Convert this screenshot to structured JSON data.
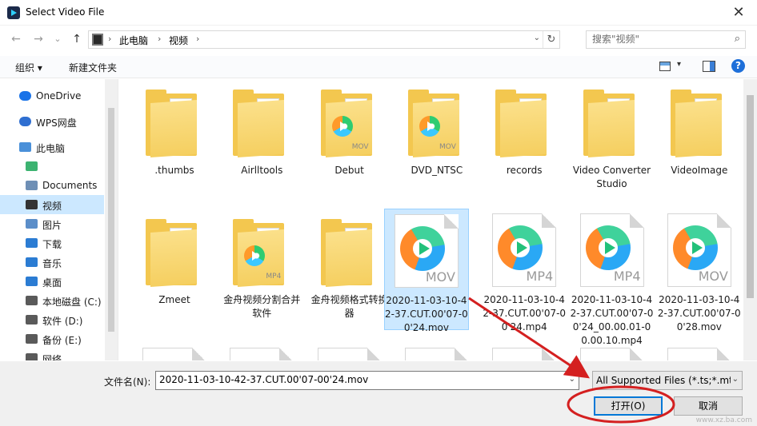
{
  "window": {
    "title": "Select Video File",
    "close_glyph": "✕"
  },
  "nav": {
    "back_glyph": "←",
    "forward_glyph": "→",
    "recent_glyph": "⌄",
    "up_glyph": "↑",
    "breadcrumb": [
      "此电脑",
      "视频"
    ],
    "crumb_sep": "›",
    "dropdown_glyph": "⌄",
    "refresh_glyph": "↻",
    "search_placeholder": "搜索\"视频\"",
    "search_glyph": "⌕"
  },
  "toolbar": {
    "organize_label": "组织 ▾",
    "new_folder_label": "新建文件夹",
    "help_label": "?",
    "view_dd": "▾"
  },
  "sidebar": {
    "items": [
      {
        "label": "OneDrive",
        "icon": "cloud-icon",
        "color": "#1a73e8"
      },
      {
        "label": "WPS网盘",
        "icon": "cloud-icon",
        "color": "#2f6fd1"
      },
      {
        "label": "此电脑",
        "icon": "computer-icon",
        "color": "#4a90d9"
      },
      {
        "label": "",
        "icon": "app-icon",
        "color": "#3cb371"
      },
      {
        "label": "Documents",
        "icon": "document-icon",
        "color": "#6e8fb5"
      },
      {
        "label": "视频",
        "icon": "video-folder-icon",
        "color": "#333333"
      },
      {
        "label": "图片",
        "icon": "picture-icon",
        "color": "#5b8ec9"
      },
      {
        "label": "下载",
        "icon": "download-icon",
        "color": "#2b7cd3"
      },
      {
        "label": "音乐",
        "icon": "music-icon",
        "color": "#2b7cd3"
      },
      {
        "label": "桌面",
        "icon": "desktop-icon",
        "color": "#2b7cd3"
      },
      {
        "label": "本地磁盘 (C:)",
        "icon": "drive-icon",
        "color": "#5a5a5a"
      },
      {
        "label": "软件 (D:)",
        "icon": "drive-icon",
        "color": "#5a5a5a"
      },
      {
        "label": "备份 (E:)",
        "icon": "drive-icon",
        "color": "#5a5a5a"
      },
      {
        "label": "网络",
        "icon": "network-icon",
        "color": "#5a5a5a"
      }
    ],
    "selected_index": 5
  },
  "files": [
    {
      "name": ".thumbs",
      "kind": "folder",
      "ext": ""
    },
    {
      "name": "Airlltools",
      "kind": "folder",
      "ext": ""
    },
    {
      "name": "Debut",
      "kind": "folder",
      "ext": "MOV"
    },
    {
      "name": "DVD_NTSC",
      "kind": "folder",
      "ext": "MOV"
    },
    {
      "name": "records",
      "kind": "folder",
      "ext": ""
    },
    {
      "name": "Video Converter Studio",
      "kind": "folder",
      "ext": ""
    },
    {
      "name": "VideoImage",
      "kind": "folder",
      "ext": ""
    },
    {
      "name": "Zmeet",
      "kind": "folder",
      "ext": ""
    },
    {
      "name": "金舟视频分割合并软件",
      "kind": "folder",
      "ext": "MP4"
    },
    {
      "name": "金舟视频格式转换器",
      "kind": "folder",
      "ext": ""
    },
    {
      "name": "2020-11-03-10-42-37.CUT.00'07-00'24.mov",
      "kind": "video",
      "ext": "MOV"
    },
    {
      "name": "2020-11-03-10-42-37.CUT.00'07-00'24.mp4",
      "kind": "video",
      "ext": "MP4"
    },
    {
      "name": "2020-11-03-10-42-37.CUT.00'07-00'24_00.00.01-00.00.10.mp4",
      "kind": "video",
      "ext": "MP4"
    },
    {
      "name": "2020-11-03-10-42-37.CUT.00'07-00'28.mov",
      "kind": "video",
      "ext": "MOV"
    }
  ],
  "selected_file_index": 10,
  "bottom": {
    "filename_label": "文件名(N):",
    "filename_value": "2020-11-03-10-42-37.CUT.00'07-00'24.mov",
    "filter_value": "All Supported Files (*.ts;*.mts",
    "dd_glyph": "⌄",
    "open_label": "打开(O)",
    "cancel_label": "取消"
  },
  "annotation": {
    "color": "#d42020"
  },
  "watermark": "www.xz.ba.com"
}
